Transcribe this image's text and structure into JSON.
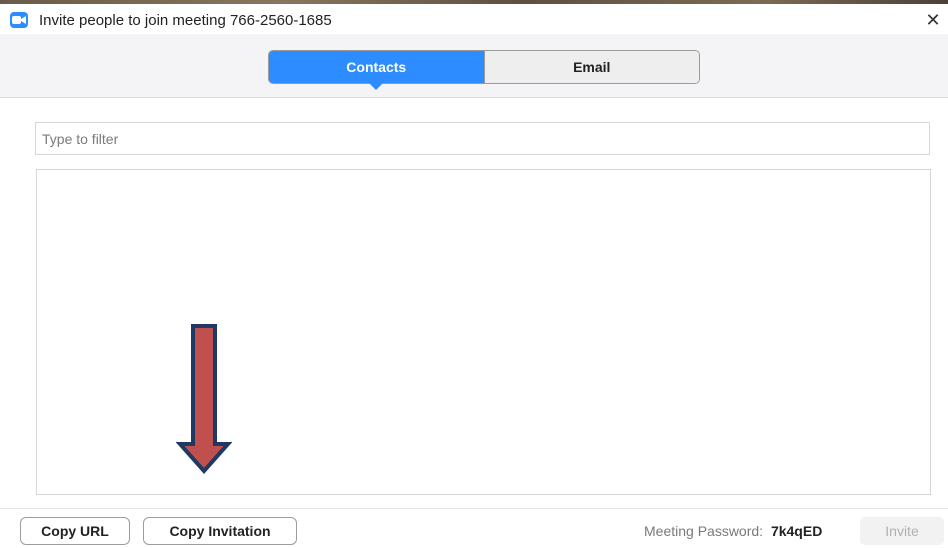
{
  "window": {
    "title": "Invite people to join meeting 766-2560-1685",
    "app_icon": "zoom-camera-icon",
    "close_icon": "close-icon",
    "close_glyph": "✕"
  },
  "tabs": [
    {
      "label": "Contacts",
      "active": true
    },
    {
      "label": "Email",
      "active": false
    }
  ],
  "filter": {
    "placeholder": "Type to filter",
    "value": ""
  },
  "contacts": [],
  "footer": {
    "copy_url_label": "Copy URL",
    "copy_invitation_label": "Copy Invitation",
    "password_label": "Meeting Password:",
    "password_value": "7k4qED",
    "invite_label": "Invite",
    "invite_enabled": false
  },
  "annotation": {
    "icon": "down-arrow-icon",
    "fill": "#c0504d",
    "stroke": "#1f3864"
  },
  "colors": {
    "accent": "#2d8cff"
  }
}
